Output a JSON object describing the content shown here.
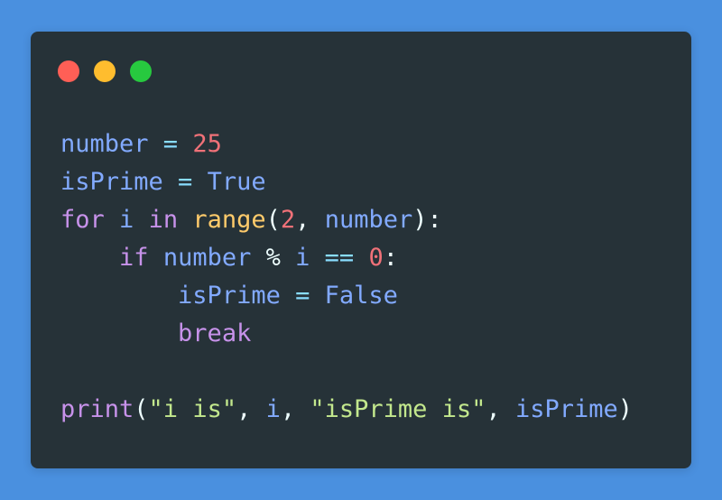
{
  "colors": {
    "page_background": "#4a90df",
    "window_background": "#263238",
    "dot_red": "#ff5f56",
    "dot_yellow": "#ffbd2e",
    "dot_green": "#27c93f",
    "variable": "#82aaff",
    "number": "#f07178",
    "keyword": "#c792ea",
    "builtin_function": "#ffcb6b",
    "string": "#c3e88d",
    "operator": "#89ddff",
    "punctuation": "#eeffff"
  },
  "window_controls": [
    "close-dot",
    "minimize-dot",
    "maximize-dot"
  ],
  "code_lines": [
    [
      {
        "text": "number",
        "role": "variable"
      },
      {
        "text": " = ",
        "role": "operator"
      },
      {
        "text": "25",
        "role": "number"
      }
    ],
    [
      {
        "text": "isPrime",
        "role": "variable"
      },
      {
        "text": " = ",
        "role": "operator"
      },
      {
        "text": "True",
        "role": "variable"
      }
    ],
    [
      {
        "text": "for",
        "role": "keyword"
      },
      {
        "text": " ",
        "role": "punctuation"
      },
      {
        "text": "i",
        "role": "variable"
      },
      {
        "text": " ",
        "role": "punctuation"
      },
      {
        "text": "in",
        "role": "keyword"
      },
      {
        "text": " ",
        "role": "punctuation"
      },
      {
        "text": "range",
        "role": "builtin_function"
      },
      {
        "text": "(",
        "role": "punctuation"
      },
      {
        "text": "2",
        "role": "number"
      },
      {
        "text": ", ",
        "role": "punctuation"
      },
      {
        "text": "number",
        "role": "variable"
      },
      {
        "text": "):",
        "role": "punctuation"
      }
    ],
    [
      {
        "text": "    ",
        "role": "punctuation"
      },
      {
        "text": "if",
        "role": "keyword"
      },
      {
        "text": " ",
        "role": "punctuation"
      },
      {
        "text": "number",
        "role": "variable"
      },
      {
        "text": " % ",
        "role": "punctuation"
      },
      {
        "text": "i",
        "role": "variable"
      },
      {
        "text": " == ",
        "role": "operator"
      },
      {
        "text": "0",
        "role": "number"
      },
      {
        "text": ":",
        "role": "punctuation"
      }
    ],
    [
      {
        "text": "        ",
        "role": "punctuation"
      },
      {
        "text": "isPrime",
        "role": "variable"
      },
      {
        "text": " = ",
        "role": "operator"
      },
      {
        "text": "False",
        "role": "variable"
      }
    ],
    [
      {
        "text": "        ",
        "role": "punctuation"
      },
      {
        "text": "break",
        "role": "keyword"
      }
    ],
    [],
    [
      {
        "text": "print",
        "role": "keyword"
      },
      {
        "text": "(",
        "role": "punctuation"
      },
      {
        "text": "\"i is\"",
        "role": "string"
      },
      {
        "text": ", ",
        "role": "punctuation"
      },
      {
        "text": "i",
        "role": "variable"
      },
      {
        "text": ", ",
        "role": "punctuation"
      },
      {
        "text": "\"isPrime is\"",
        "role": "string"
      },
      {
        "text": ", ",
        "role": "punctuation"
      },
      {
        "text": "isPrime",
        "role": "variable"
      },
      {
        "text": ")",
        "role": "punctuation"
      }
    ]
  ]
}
